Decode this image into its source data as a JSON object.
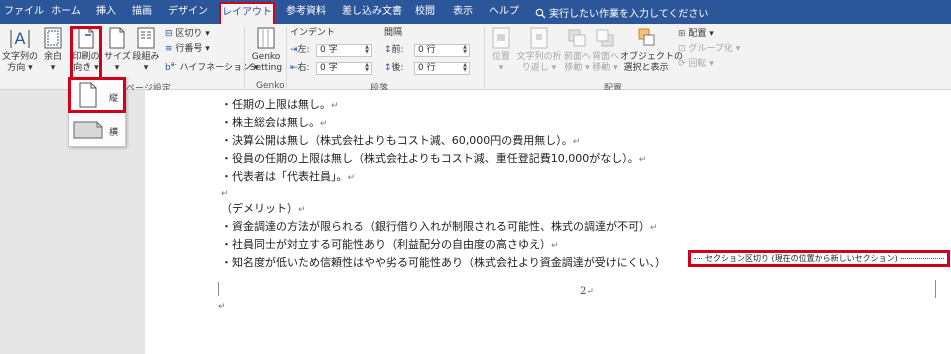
{
  "tabs": [
    "ファイル",
    "ホーム",
    "挿入",
    "描画",
    "デザイン",
    "レイアウト",
    "参考資料",
    "差し込み文書",
    "校閲",
    "表示",
    "ヘルプ"
  ],
  "active_tab": "レイアウト",
  "tell_me": "実行したい作業を入力してください",
  "ribbon": {
    "text_direction": [
      "文字列の",
      "方向 ▾"
    ],
    "margins": [
      "余白",
      "▾"
    ],
    "orientation": [
      "印刷の",
      "向き ▾"
    ],
    "size": [
      "サイズ",
      "▾"
    ],
    "columns": [
      "段組み",
      "▾"
    ],
    "breaks": "区切り ▾",
    "line_numbers": "行番号 ▾",
    "hyphenation": "ハイフネーション ▾",
    "page_setup_label": "ページ設定",
    "genko": [
      "Genko",
      "Setting"
    ],
    "genko_label": "Genko",
    "indent_title": "インデント",
    "spacing_title": "間隔",
    "indent_left_label": "左:",
    "indent_left_value": "0 字",
    "indent_right_label": "右:",
    "indent_right_value": "0 字",
    "space_before_label": "前:",
    "space_before_value": "0 行",
    "space_after_label": "後:",
    "space_after_value": "0 行",
    "paragraph_label": "段落",
    "position": [
      "位置",
      "▾"
    ],
    "wrap_text": [
      "文字列の折",
      "り返し ▾"
    ],
    "bring_forward": [
      "前面へ",
      "移動 ▾"
    ],
    "send_backward": [
      "背面へ",
      "移動 ▾"
    ],
    "selection_pane": [
      "オブジェクトの",
      "選択と表示"
    ],
    "align": "配置 ▾",
    "group": "グループ化 ▾",
    "rotate": "回転 ▾",
    "arrange_label": "配置"
  },
  "orientation_menu": {
    "portrait": "縦",
    "landscape": "横"
  },
  "document": {
    "lines": [
      "・任期の上限は無し。",
      "・株主総会は無し。",
      "・決算公開は無し（株式会社よりもコスト減、60,000円の費用無し）。",
      "・役員の任期の上限は無し（株式会社よりもコスト減、重任登記費10,000がなし）。",
      "・代表者は「代表社員」。",
      "",
      "（デメリット）",
      "・資金調達の方法が限られる（銀行借り入れが制限される可能性、株式の調達が不可）",
      "・社員同士が対立する可能性あり（利益配分の自由度の高さゆえ）",
      "・知名度が低いため信頼性はやや劣る可能性あり（株式会社より資金調達が受けにくい、）"
    ],
    "paragraph_mark": "↵",
    "section_break": "セクション区切り (現在の位置から新しいセクション)",
    "page_number": "2"
  },
  "colors": {
    "tabbar": "#2b579a",
    "highlight": "#d0021b"
  }
}
